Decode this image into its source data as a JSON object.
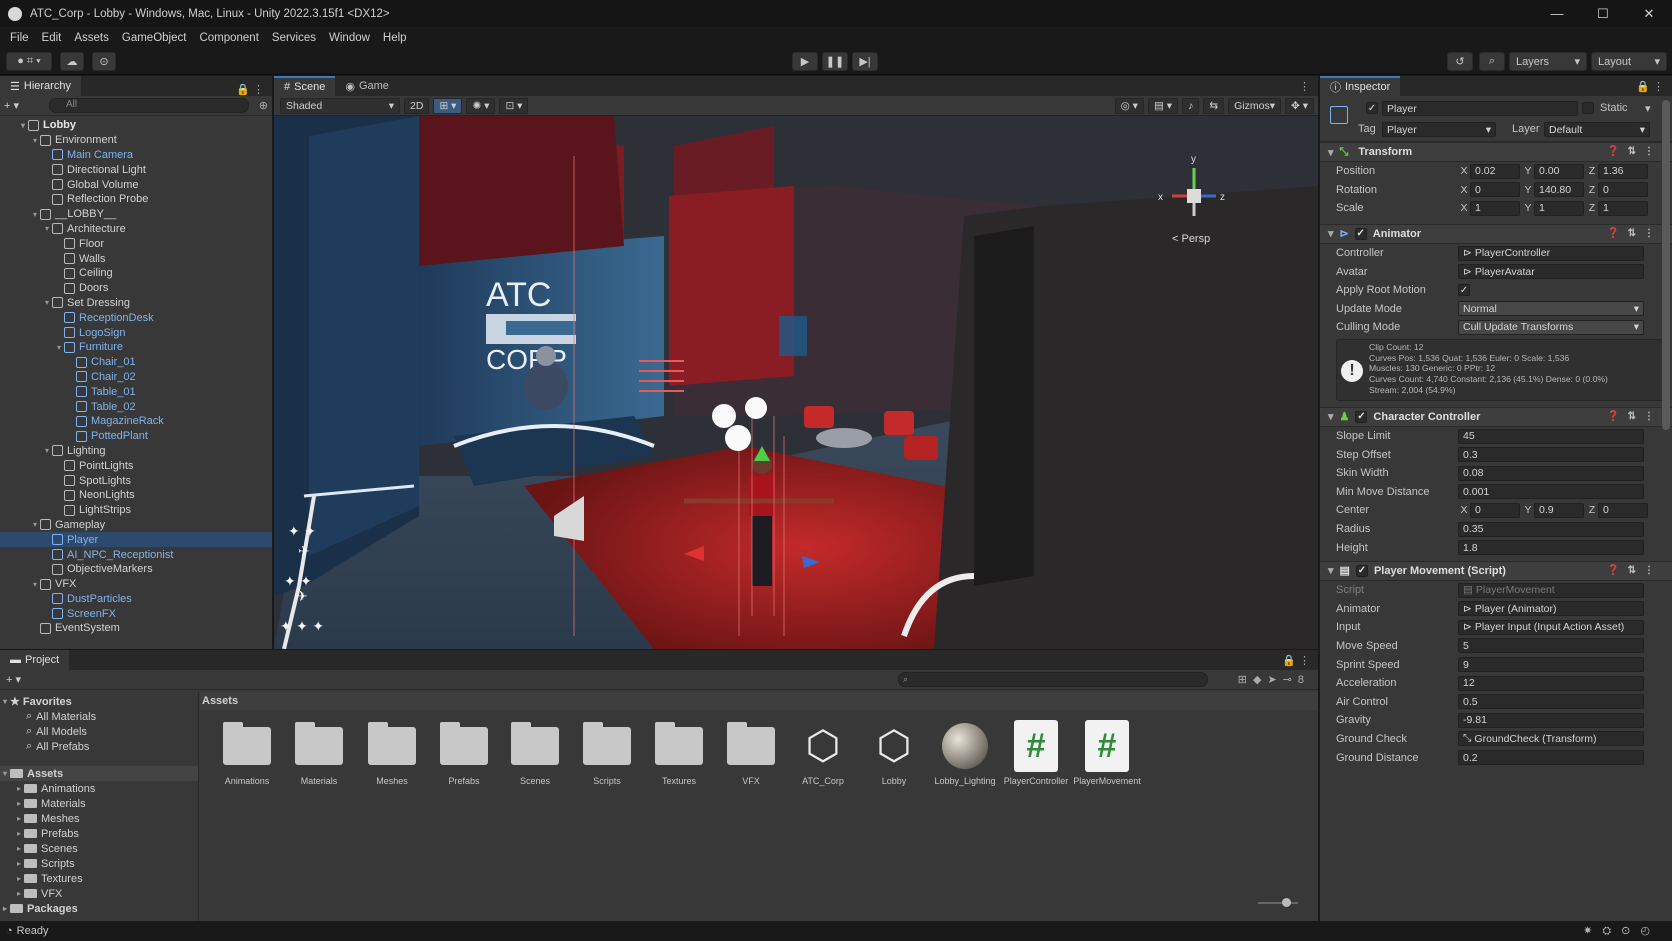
{
  "window": {
    "title": "ATC_Corp - Lobby - Windows, Mac, Linux - Unity 2022.3.15f1 <DX12>",
    "controls": [
      "—",
      "☐",
      "✕"
    ]
  },
  "menu": [
    "File",
    "Edit",
    "Assets",
    "GameObject",
    "Component",
    "Services",
    "Window",
    "Help"
  ],
  "toolbar": {
    "layers_label": "Layers",
    "layout_label": "Layout"
  },
  "hierarchy": {
    "tab": "Hierarchy",
    "search_placeholder": "All",
    "items": [
      {
        "label": "Lobby",
        "depth": 0,
        "root": true
      },
      {
        "label": "Environment",
        "depth": 1
      },
      {
        "label": "Main Camera",
        "depth": 2,
        "prefab": true
      },
      {
        "label": "Directional Light",
        "depth": 2
      },
      {
        "label": "Global Volume",
        "depth": 2
      },
      {
        "label": "Reflection Probe",
        "depth": 2
      },
      {
        "label": "__LOBBY__",
        "depth": 1
      },
      {
        "label": "Architecture",
        "depth": 2
      },
      {
        "label": "Floor",
        "depth": 3
      },
      {
        "label": "Walls",
        "depth": 3
      },
      {
        "label": "Ceiling",
        "depth": 3
      },
      {
        "label": "Doors",
        "depth": 3
      },
      {
        "label": "Set Dressing",
        "depth": 2
      },
      {
        "label": "ReceptionDesk",
        "depth": 3,
        "prefab": true
      },
      {
        "label": "LogoSign",
        "depth": 3,
        "prefab": true
      },
      {
        "label": "Furniture",
        "depth": 3,
        "prefab": true
      },
      {
        "label": "Chair_01",
        "depth": 4,
        "prefab": true
      },
      {
        "label": "Chair_02",
        "depth": 4,
        "prefab": true
      },
      {
        "label": "Table_01",
        "depth": 4,
        "prefab": true
      },
      {
        "label": "Table_02",
        "depth": 4,
        "prefab": true
      },
      {
        "label": "MagazineRack",
        "depth": 4,
        "prefab": true
      },
      {
        "label": "PottedPlant",
        "depth": 4,
        "prefab": true
      },
      {
        "label": "Lighting",
        "depth": 2
      },
      {
        "label": "PointLights",
        "depth": 3
      },
      {
        "label": "SpotLights",
        "depth": 3
      },
      {
        "label": "NeonLights",
        "depth": 3
      },
      {
        "label": "LightStrips",
        "depth": 3
      },
      {
        "label": "Gameplay",
        "depth": 1
      },
      {
        "label": "Player",
        "depth": 2,
        "prefab": true,
        "selected": true
      },
      {
        "label": "AI_NPC_Receptionist",
        "depth": 2,
        "prefab": true
      },
      {
        "label": "ObjectiveMarkers",
        "depth": 2
      },
      {
        "label": "VFX",
        "depth": 1
      },
      {
        "label": "DustParticles",
        "depth": 2,
        "prefab": true
      },
      {
        "label": "ScreenFX",
        "depth": 2,
        "prefab": true
      },
      {
        "label": "EventSystem",
        "depth": 1
      }
    ]
  },
  "scene": {
    "tabs": [
      "Scene",
      "Game"
    ],
    "shading_mode": "Shaded",
    "mode_2d": "2D",
    "gizmos_label": "Gizmos",
    "persp_label": "< Persp",
    "axis_labels": {
      "x": "x",
      "y": "y",
      "z": "z"
    },
    "sign_lines": [
      "ATC",
      "CORP"
    ]
  },
  "inspector": {
    "tab": "Inspector",
    "object_name": "Player",
    "static_label": "Static",
    "tag_label": "Tag",
    "tag_value": "Player",
    "layer_label": "Layer",
    "layer_value": "Default",
    "transform": {
      "title": "Transform",
      "position_label": "Position",
      "position": {
        "x": "0.02",
        "y": "0.00",
        "z": "1.36"
      },
      "rotation_label": "Rotation",
      "rotation": {
        "x": "0",
        "y": "140.80",
        "z": "0"
      },
      "scale_label": "Scale",
      "scale": {
        "x": "1",
        "y": "1",
        "z": "1"
      }
    },
    "animator": {
      "title": "Animator",
      "controller_label": "Controller",
      "controller": "PlayerController",
      "avatar_label": "Avatar",
      "avatar": "PlayerAvatar",
      "root_motion_label": "Apply Root Motion",
      "update_mode_label": "Update Mode",
      "update_mode": "Normal",
      "culling_label": "Culling Mode",
      "culling": "Cull Update Transforms",
      "info": [
        "Clip Count: 12",
        "Curves Pos: 1,536 Quat: 1,536 Euler: 0 Scale: 1,536",
        "Muscles: 130 Generic: 0 PPtr: 12",
        "Curves Count: 4,740 Constant: 2,136 (45.1%) Dense: 0 (0.0%)",
        "Stream: 2,004 (54.9%)"
      ]
    },
    "character_controller": {
      "title": "Character Controller",
      "slope_label": "Slope Limit",
      "slope": "45",
      "step_label": "Step Offset",
      "step": "0.3",
      "skin_label": "Skin Width",
      "skin": "0.08",
      "minmove_label": "Min Move Distance",
      "minmove": "0.001",
      "center_label": "Center",
      "center": {
        "x": "0",
        "y": "0.9",
        "z": "0"
      },
      "radius_label": "Radius",
      "radius": "0.35",
      "height_label": "Height",
      "height": "1.8"
    },
    "player_movement": {
      "title": "Player Movement (Script)",
      "script_label": "Script",
      "script": "PlayerMovement",
      "animator_label": "Animator",
      "animator": "Player (Animator)",
      "input_label": "Input",
      "input": "Player Input (Input Action Asset)",
      "move_label": "Move Speed",
      "move": "5",
      "sprint_label": "Sprint Speed",
      "sprint": "9",
      "accel_label": "Acceleration",
      "accel": "12",
      "air_label": "Air Control",
      "air": "0.5",
      "gravity_label": "Gravity",
      "gravity": "-9.81",
      "groundcheck_label": "Ground Check",
      "groundcheck": "GroundCheck (Transform)",
      "grounddist_label": "Ground Distance",
      "grounddist": "0.2"
    }
  },
  "project": {
    "tab": "Project",
    "breadcrumb": "Assets",
    "favorites_label": "Favorites",
    "favorites": [
      "All Materials",
      "All Models",
      "All Prefabs"
    ],
    "assets_label": "Assets",
    "folders": [
      "Animations",
      "Materials",
      "Meshes",
      "Prefabs",
      "Scenes",
      "Scripts",
      "Textures",
      "VFX"
    ],
    "packages_label": "Packages",
    "grid": [
      {
        "name": "Animations",
        "kind": "folder"
      },
      {
        "name": "Materials",
        "kind": "folder"
      },
      {
        "name": "Meshes",
        "kind": "folder"
      },
      {
        "name": "Prefabs",
        "kind": "folder"
      },
      {
        "name": "Scenes",
        "kind": "folder"
      },
      {
        "name": "Scripts",
        "kind": "folder"
      },
      {
        "name": "Textures",
        "kind": "folder"
      },
      {
        "name": "VFX",
        "kind": "folder"
      },
      {
        "name": "ATC_Corp",
        "kind": "unity"
      },
      {
        "name": "Lobby",
        "kind": "unity"
      },
      {
        "name": "Lobby_Lighting",
        "kind": "sphere"
      },
      {
        "name": "PlayerController",
        "kind": "script"
      },
      {
        "name": "PlayerMovement",
        "kind": "script"
      }
    ]
  },
  "status": {
    "text": "Ready"
  },
  "colors": {
    "accent": "#3a79bb",
    "selection": "#2c4a6e",
    "prefab": "#7fb3f0",
    "script_green": "#2e8b3a"
  }
}
